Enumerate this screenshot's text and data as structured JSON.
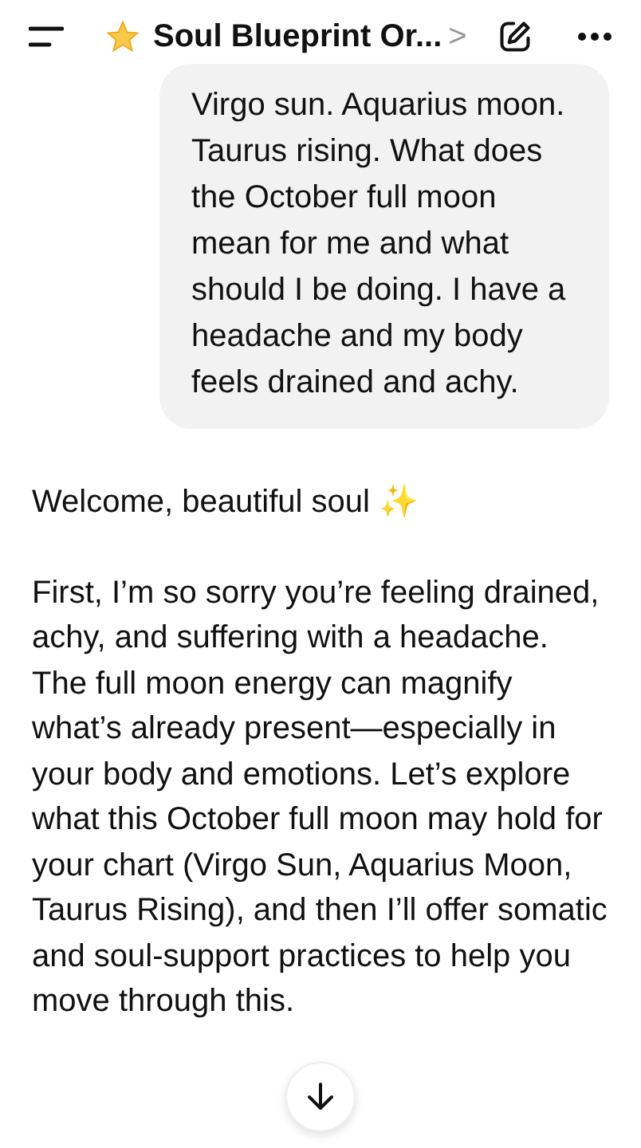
{
  "header": {
    "title": "Soul Blueprint Or...",
    "chevron": ">"
  },
  "messages": [
    {
      "kind": "bubble",
      "text": "Virgo sun. Aquarius moon. Taurus rising. What does the October full moon mean for me and what should I be doing. I have a headache and my body feels drained and achy."
    },
    {
      "kind": "reply",
      "paragraphs": [
        "Welcome, beautiful soul ✨",
        "First, I’m so sorry you’re feeling drained, achy, and suffering with a headache. The full moon energy can magnify what’s already present—especially in your body and emotions. Let’s explore what this October full moon may hold for your chart (Virgo Sun, Aquarius Moon, Taurus Rising), and then I’ll offer somatic and soul-support practices to help you move through this."
      ]
    }
  ]
}
